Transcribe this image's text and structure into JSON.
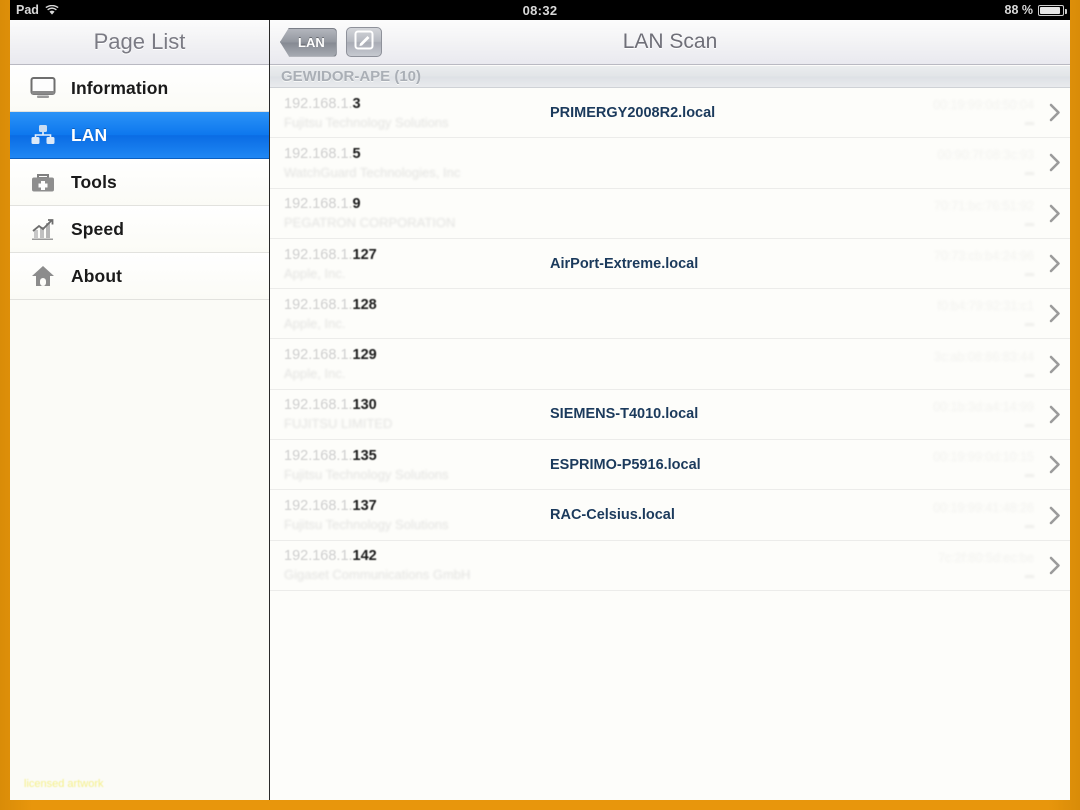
{
  "status_bar": {
    "device_label": "Pad",
    "wifi_icon": "wifi-icon",
    "time": "08:32",
    "battery_percent": "88 %",
    "battery_icon": "battery-icon"
  },
  "sidebar": {
    "title": "Page List",
    "items": [
      {
        "label": "Information",
        "icon": "monitor-icon",
        "selected": false
      },
      {
        "label": "LAN",
        "icon": "network-nodes-icon",
        "selected": true
      },
      {
        "label": "Tools",
        "icon": "toolbox-icon",
        "selected": false
      },
      {
        "label": "Speed",
        "icon": "chart-icon",
        "selected": false
      },
      {
        "label": "About",
        "icon": "home-icon",
        "selected": false
      }
    ],
    "watermark": "licensed artwork"
  },
  "navbar": {
    "back_label": "LAN",
    "back_icon": "back-arrow-icon",
    "edit_icon": "compose-icon",
    "title": "LAN Scan"
  },
  "section": {
    "header": "GEWIDOR-APE (10)"
  },
  "devices": [
    {
      "ip_prefix": "192.168.1.",
      "ip_host": "3",
      "vendor": "Fujitsu Technology Solutions",
      "hostname": "PRIMERGY2008R2.local",
      "mac": "00:19:99:0d:50:04",
      "chevron": "chevron-right-icon"
    },
    {
      "ip_prefix": "192.168.1.",
      "ip_host": "5",
      "vendor": "WatchGuard Technologies, Inc",
      "hostname": "",
      "mac": "00:90:7f:08:3c:93",
      "chevron": "chevron-right-icon"
    },
    {
      "ip_prefix": "192.168.1.",
      "ip_host": "9",
      "vendor": "PEGATRON CORPORATION",
      "hostname": "",
      "mac": "70:71:bc:76:51:92",
      "chevron": "chevron-right-icon"
    },
    {
      "ip_prefix": "192.168.1.",
      "ip_host": "127",
      "vendor": "Apple, Inc.",
      "hostname": "AirPort-Extreme.local",
      "mac": "70:73:cb:b4:24:96",
      "chevron": "chevron-right-icon"
    },
    {
      "ip_prefix": "192.168.1.",
      "ip_host": "128",
      "vendor": "Apple, Inc.",
      "hostname": "",
      "mac": "f0:b4:79:92:31:c1",
      "chevron": "chevron-right-icon"
    },
    {
      "ip_prefix": "192.168.1.",
      "ip_host": "129",
      "vendor": "Apple, Inc.",
      "hostname": "",
      "mac": "3c:ab:08:86:83:44",
      "chevron": "chevron-right-icon"
    },
    {
      "ip_prefix": "192.168.1.",
      "ip_host": "130",
      "vendor": "FUJITSU LIMITED",
      "hostname": "SIEMENS-T4010.local",
      "mac": "00:1b:3d:a4:14:99",
      "chevron": "chevron-right-icon"
    },
    {
      "ip_prefix": "192.168.1.",
      "ip_host": "135",
      "vendor": "Fujitsu Technology Solutions",
      "hostname": "ESPRIMO-P5916.local",
      "mac": "00:19:99:0d:10:15",
      "chevron": "chevron-right-icon"
    },
    {
      "ip_prefix": "192.168.1.",
      "ip_host": "137",
      "vendor": "Fujitsu Technology Solutions",
      "hostname": "RAC-Celsius.local",
      "mac": "00:19:99:41:48:26",
      "chevron": "chevron-right-icon"
    },
    {
      "ip_prefix": "192.168.1.",
      "ip_host": "142",
      "vendor": "Gigaset Communications GmbH",
      "hostname": "",
      "mac": "7c:2f:80:5d:ec:be",
      "chevron": "chevron-right-icon"
    }
  ],
  "colors": {
    "frame_orange": "#E8960C",
    "accent_blue": "#0d77ee",
    "hostname_blue": "#1b3a5c"
  }
}
